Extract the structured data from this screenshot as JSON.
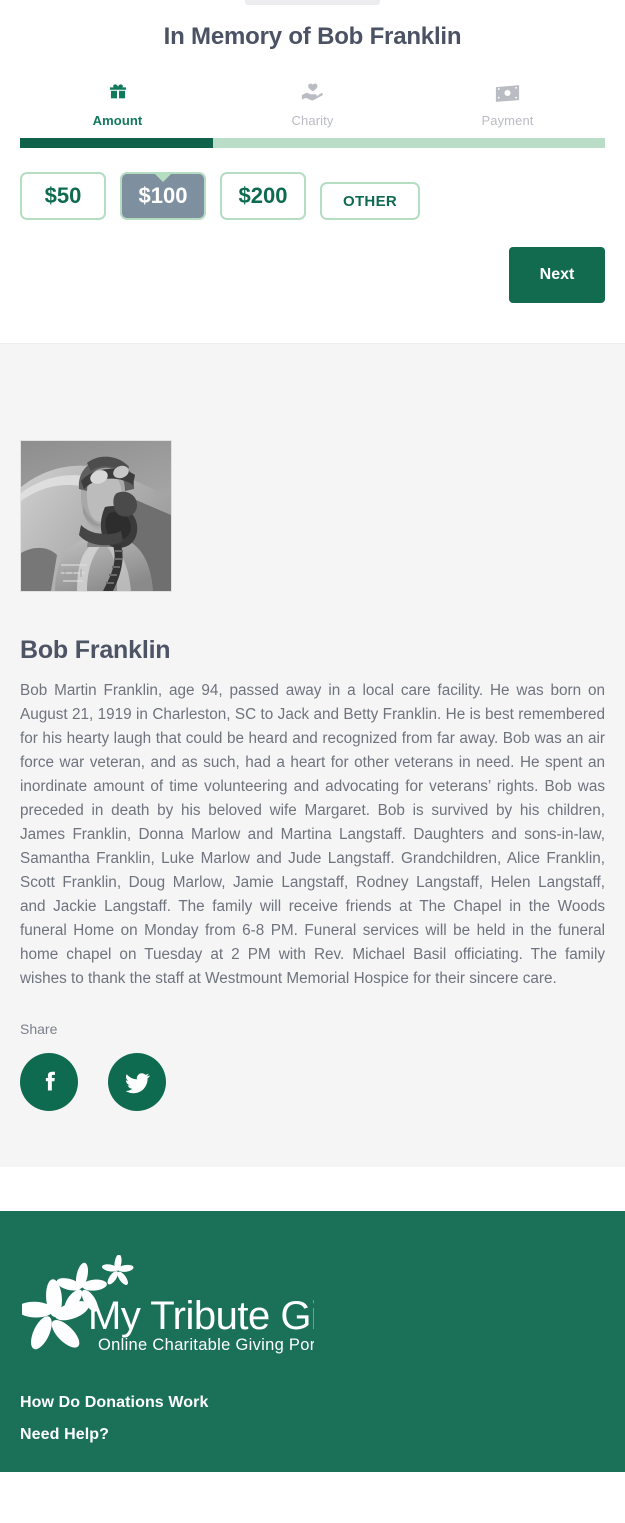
{
  "header": {
    "title": "In Memory of Bob Franklin"
  },
  "steps": [
    {
      "label": "Amount",
      "icon": "gift-icon",
      "state": "active"
    },
    {
      "label": "Charity",
      "icon": "hand-heart-icon",
      "state": "inactive"
    },
    {
      "label": "Payment",
      "icon": "banknote-icon",
      "state": "inactive"
    }
  ],
  "progress": {
    "percent": 33,
    "fill_color": "#10634a",
    "track_color": "#b9ddc6"
  },
  "amounts": {
    "options": [
      {
        "label": "$50",
        "selected": false
      },
      {
        "label": "$100",
        "selected": true
      },
      {
        "label": "$200",
        "selected": false
      }
    ],
    "other_label": "OTHER",
    "selected_value": "$100",
    "selected_bg": "#7e909f",
    "border_color": "#b5ddc2",
    "text_color": "#0f6b4f"
  },
  "actions": {
    "next_label": "Next",
    "next_bg": "#136b4f"
  },
  "obituary": {
    "portrait_alt": "Black and white photograph of a World War II airman in flight gear looking upward",
    "name": "Bob Franklin",
    "body": "Bob Martin Franklin, age 94, passed away in a local care facility. He was born on August 21, 1919 in Charleston, SC to Jack and Betty Franklin. He is best remembered for his hearty laugh that could be heard and recognized from far away. Bob was an air force war veteran, and as such, had a heart for other veterans in need. He spent an inordinate amount of time volunteering and advocating for veterans’ rights. Bob was preceded in death by his beloved wife Margaret. Bob is survived by his children, James Franklin, Donna Marlow and Martina Langstaff. Daughters and sons-in-law, Samantha Franklin, Luke Marlow and Jude Langstaff. Grandchildren, Alice Franklin, Scott Franklin, Doug Marlow, Jamie Langstaff, Rodney Langstaff, Helen Langstaff, and Jackie Langstaff. The family will receive friends at The Chapel in the Woods funeral Home on Monday from 6-8 PM. Funeral services will be held in the funeral home chapel on Tuesday at 2 PM with Rev. Michael Basil officiating. The family wishes to thank the staff at Westmount Memorial Hospice for their sincere care.",
    "share_label": "Share",
    "share_buttons": [
      {
        "icon": "facebook-icon",
        "name": "Facebook"
      },
      {
        "icon": "twitter-icon",
        "name": "Twitter"
      }
    ]
  },
  "footer": {
    "logo_title": "My Tribute Gift",
    "logo_tagline": "Online Charitable Giving Portal",
    "background": "#1a7158",
    "links": [
      {
        "label": "How Do Donations Work"
      },
      {
        "label": "Need Help?"
      }
    ]
  }
}
